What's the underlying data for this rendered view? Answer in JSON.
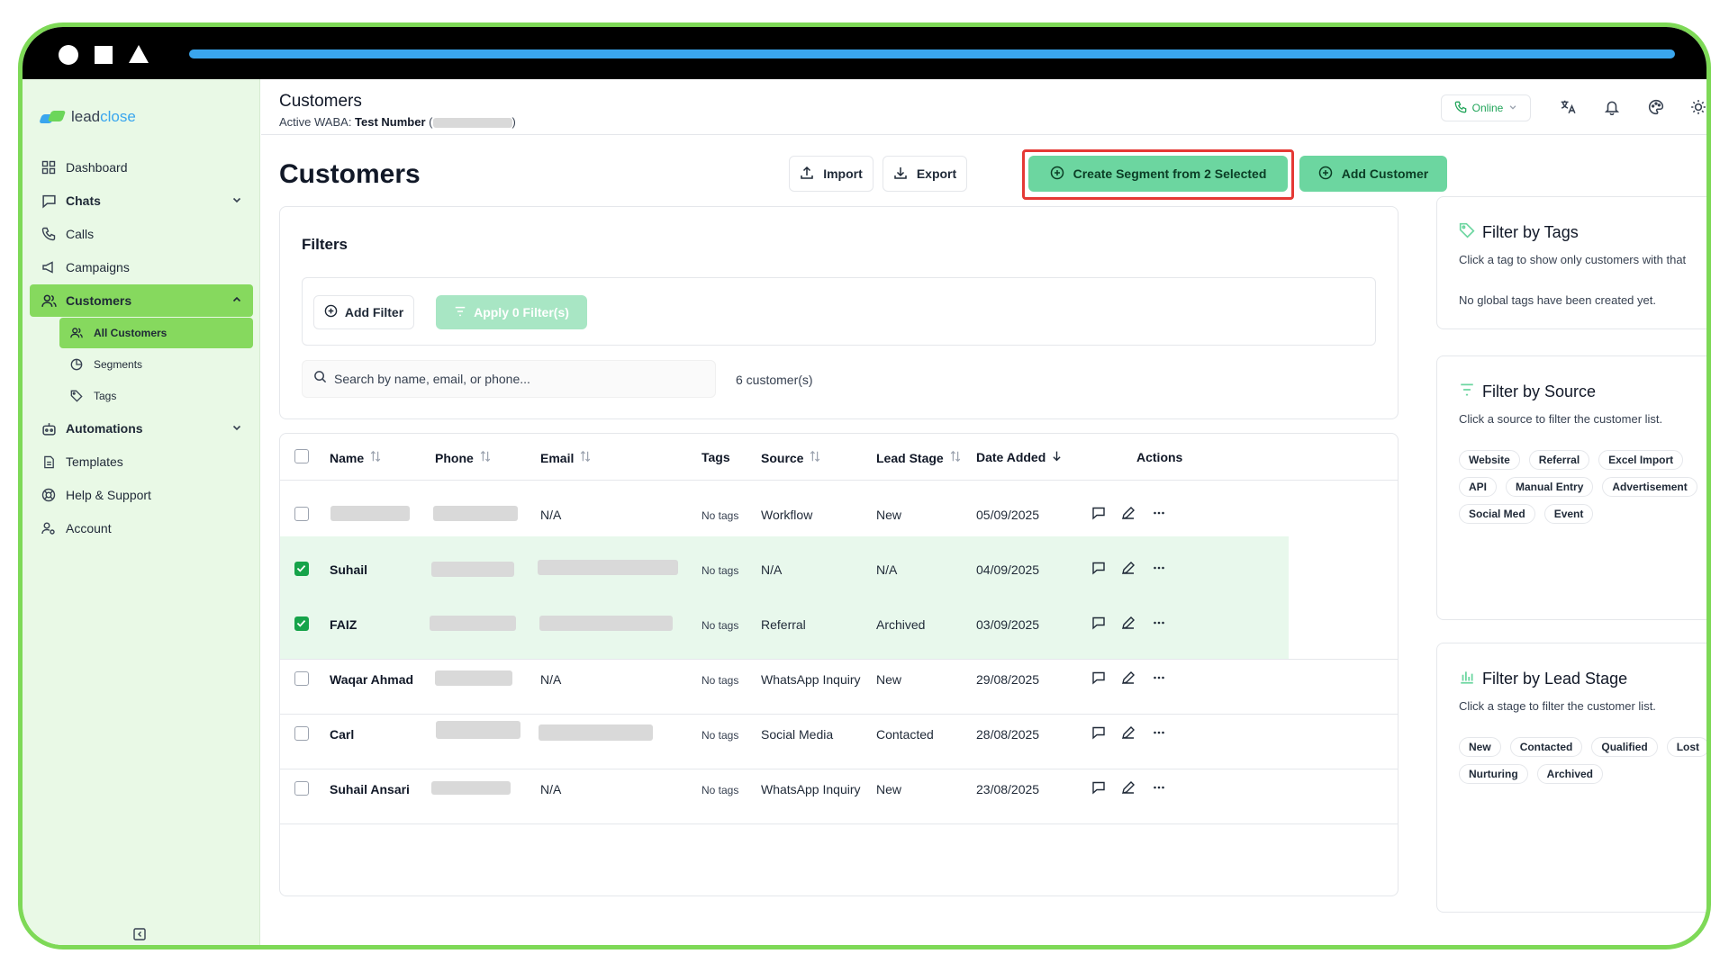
{
  "app": {
    "logo_part1": "lead",
    "logo_part2": "close"
  },
  "sidebar": {
    "items": [
      {
        "label": "Dashboard"
      },
      {
        "label": "Chats"
      },
      {
        "label": "Calls"
      },
      {
        "label": "Campaigns"
      },
      {
        "label": "Customers"
      },
      {
        "label": "Automations"
      },
      {
        "label": "Templates"
      },
      {
        "label": "Help & Support"
      },
      {
        "label": "Account"
      }
    ],
    "sub_items": [
      {
        "label": "All Customers"
      },
      {
        "label": "Segments"
      },
      {
        "label": "Tags"
      }
    ]
  },
  "header": {
    "title": "Customers",
    "waba_prefix": "Active WABA: ",
    "waba_name": "Test Number",
    "paren_open": "(",
    "paren_close": ")",
    "status": "Online"
  },
  "main": {
    "title": "Customers",
    "import_label": "Import",
    "export_label": "Export",
    "segment_label": "Create Segment from 2 Selected",
    "add_customer_label": "Add Customer"
  },
  "filters": {
    "title": "Filters",
    "add_filter": "Add Filter",
    "apply_filter": "Apply 0 Filter(s)",
    "search_placeholder": "Search by name, email, or phone...",
    "count": "6 customer(s)"
  },
  "table": {
    "headers": [
      "Name",
      "Phone",
      "Email",
      "Tags",
      "Source",
      "Lead Stage",
      "Date Added",
      "Actions"
    ],
    "rows": [
      {
        "name": "",
        "email": "N/A",
        "tags": "No tags",
        "source": "Workflow",
        "stage": "New",
        "date": "05/09/2025",
        "selected": false
      },
      {
        "name": "Suhail",
        "email": "",
        "tags": "No tags",
        "source": "N/A",
        "stage": "N/A",
        "date": "04/09/2025",
        "selected": true
      },
      {
        "name": "FAIZ",
        "email": "",
        "tags": "No tags",
        "source": "Referral",
        "stage": "Archived",
        "date": "03/09/2025",
        "selected": true
      },
      {
        "name": "Waqar Ahmad",
        "email": "N/A",
        "tags": "No tags",
        "source": "WhatsApp Inquiry",
        "stage": "New",
        "date": "29/08/2025",
        "selected": false
      },
      {
        "name": "Carl",
        "email": "",
        "tags": "No tags",
        "source": "Social Media",
        "stage": "Contacted",
        "date": "28/08/2025",
        "selected": false
      },
      {
        "name": "Suhail Ansari",
        "email": "N/A",
        "tags": "No tags",
        "source": "WhatsApp Inquiry",
        "stage": "New",
        "date": "23/08/2025",
        "selected": false
      }
    ]
  },
  "right": {
    "tags": {
      "title": "Filter by Tags",
      "desc": "Click a tag to show only customers with that",
      "empty": "No global tags have been created yet."
    },
    "source": {
      "title": "Filter by Source",
      "desc": "Click a source to filter the customer list.",
      "chips": [
        "Website",
        "Referral",
        "Excel Import",
        "API",
        "Manual Entry",
        "Advertisement",
        "Social Med",
        "Event"
      ]
    },
    "stage": {
      "title": "Filter by Lead Stage",
      "desc": "Click a stage to filter the customer list.",
      "chips": [
        "New",
        "Contacted",
        "Qualified",
        "Lost",
        "Nurturing",
        "Archived"
      ]
    }
  },
  "colors": {
    "accent_green": "#86d95e",
    "button_green": "#6cd6a0",
    "frame_green": "#7ed957",
    "highlight_red": "#e53935",
    "online_green": "#22a55a"
  }
}
